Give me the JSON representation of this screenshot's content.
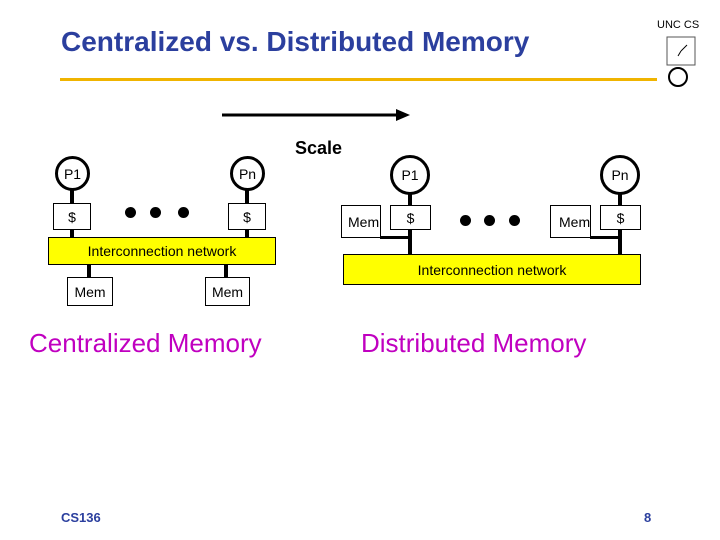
{
  "title": "Centralized vs. Distributed Memory",
  "scale_label": "Scale",
  "centralized": {
    "p1": "P1",
    "pn": "Pn",
    "cache": "$",
    "network": "Interconnection network",
    "mem": "Mem",
    "label": "Centralized Memory"
  },
  "distributed": {
    "p1": "P1",
    "pn": "Pn",
    "cache": "$",
    "network": "Interconnection network",
    "mem": "Mem",
    "label": "Distributed Memory"
  },
  "footer": {
    "course": "CS136",
    "page": "8"
  },
  "colors": {
    "title": "#2b3f9e",
    "accent_rule": "#f0b400",
    "network": "#ffff00",
    "label": "#c000c0"
  },
  "logo": {
    "text": "UNC CS",
    "icon": "unicycle-clock-logo"
  }
}
